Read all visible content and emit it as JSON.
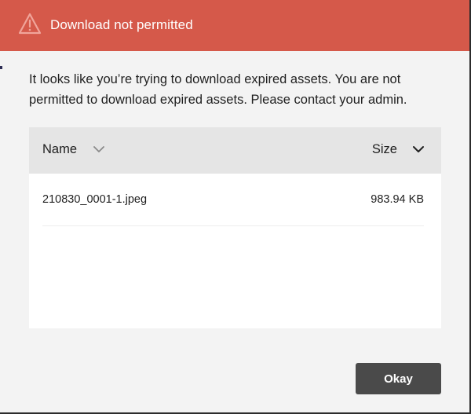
{
  "dialog": {
    "title": "Download not permitted",
    "header_color": "#d5594a",
    "icon": "warning-triangle-icon",
    "message": "It looks like you’re trying to download expired assets. You are not permitted to download expired assets. Please contact your admin.",
    "confirm_label": "Okay"
  },
  "table": {
    "columns": [
      {
        "label": "Name",
        "sort_icon": "chevron-down-icon"
      },
      {
        "label": "Size",
        "sort_icon": "chevron-down-icon"
      }
    ],
    "rows": [
      {
        "name": "210830_0001-1.jpeg",
        "size": "983.94 KB"
      }
    ]
  }
}
